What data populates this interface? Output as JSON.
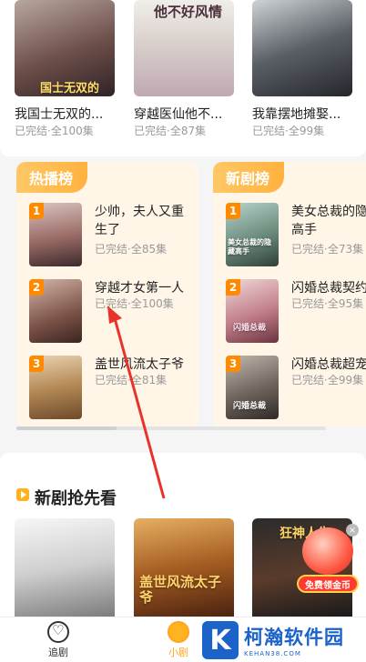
{
  "top_row": [
    {
      "title": "我国士无双的...",
      "meta": "已完结·全100集",
      "poster_text": "国士无双的"
    },
    {
      "title": "穿越医仙他不...",
      "meta": "已完结·全87集",
      "poster_text": "他不好风情"
    },
    {
      "title": "我靠摆地摊娶...",
      "meta": "已完结·全99集",
      "poster_text": ""
    }
  ],
  "hot_list": {
    "tab": "热播榜",
    "items": [
      {
        "rank": "1",
        "title": "少帅，夫人又重生了",
        "meta": "已完结·全85集"
      },
      {
        "rank": "2",
        "title": "穿越才女第一人",
        "meta": "已完结·全100集"
      },
      {
        "rank": "3",
        "title": "盖世风流太子爷",
        "meta": "已完结·全81集"
      }
    ]
  },
  "new_list": {
    "tab": "新剧榜",
    "items": [
      {
        "rank": "1",
        "title": "美女总裁的隐高手",
        "meta": "已完结·全73集",
        "poster_text": "美女总裁的隐藏高手"
      },
      {
        "rank": "2",
        "title": "闪婚总裁契约",
        "meta": "已完结·全95集",
        "poster_text": "闪婚总裁"
      },
      {
        "rank": "3",
        "title": "闪婚总裁超宠",
        "meta": "已完结·全99集",
        "poster_text": "闪婚总裁"
      }
    ]
  },
  "new_section": {
    "title": "新剧抢先看",
    "posters": [
      {
        "text": ""
      },
      {
        "text": "盖世风流太子爷"
      },
      {
        "text": "狂神人生"
      }
    ]
  },
  "float_badge": {
    "label": "免费领金币",
    "close": "×"
  },
  "tabbar": {
    "items": [
      {
        "label": "追剧",
        "icon": "heart-icon"
      },
      {
        "label": "小剧",
        "icon": "theater-icon"
      }
    ]
  },
  "watermark": {
    "logo": "K",
    "main": "柯瀚软件园",
    "sub": "KEHAN38.COM"
  },
  "colors": {
    "accent": "#ffa41b",
    "rank_badge": "#ff8a00",
    "panel_bg": "#fff6e8",
    "arrow": "#e8332b"
  }
}
